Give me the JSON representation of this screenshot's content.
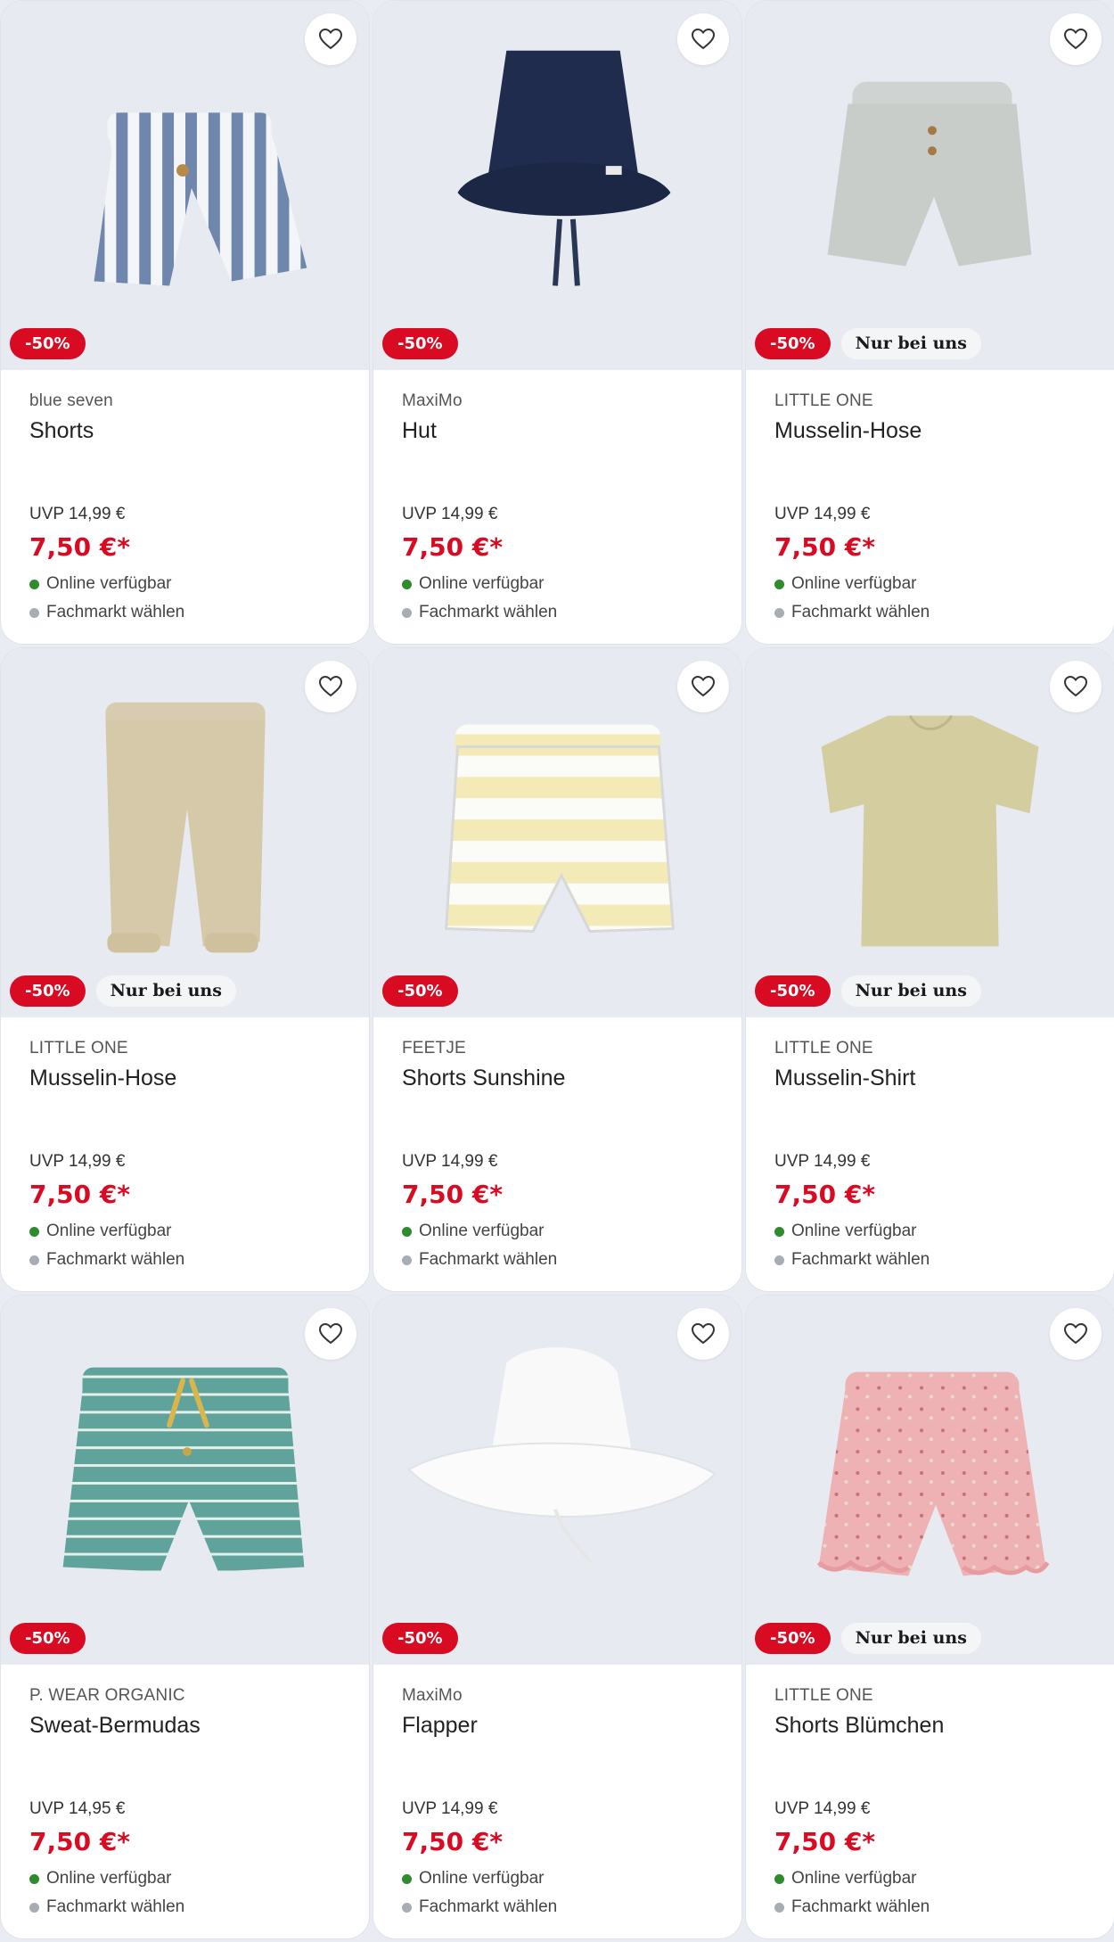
{
  "products": [
    {
      "brand": "blue seven",
      "name": "Shorts",
      "uvp": "UVP 14,99 €",
      "price": "7,50 €*",
      "discount": "-50%",
      "exclusive": "",
      "availability": "Online verfügbar",
      "store": "Fachmarkt wählen",
      "image": "striped-shorts"
    },
    {
      "brand": "MaxiMo",
      "name": "Hut",
      "uvp": "UVP 14,99 €",
      "price": "7,50 €*",
      "discount": "-50%",
      "exclusive": "",
      "availability": "Online verfügbar",
      "store": "Fachmarkt wählen",
      "image": "navy-bucket-hat"
    },
    {
      "brand": "LITTLE ONE",
      "name": "Musselin-Hose",
      "uvp": "UVP 14,99 €",
      "price": "7,50 €*",
      "discount": "-50%",
      "exclusive": "Nur bei uns",
      "availability": "Online verfügbar",
      "store": "Fachmarkt wählen",
      "image": "grey-muslin-shorts"
    },
    {
      "brand": "LITTLE ONE",
      "name": "Musselin-Hose",
      "uvp": "UVP 14,99 €",
      "price": "7,50 €*",
      "discount": "-50%",
      "exclusive": "Nur bei uns",
      "availability": "Online verfügbar",
      "store": "Fachmarkt wählen",
      "image": "beige-muslin-pants"
    },
    {
      "brand": "FEETJE",
      "name": "Shorts Sunshine",
      "uvp": "UVP 14,99 €",
      "price": "7,50 €*",
      "discount": "-50%",
      "exclusive": "",
      "availability": "Online verfügbar",
      "store": "Fachmarkt wählen",
      "image": "yellow-striped-shorts"
    },
    {
      "brand": "LITTLE ONE",
      "name": "Musselin-Shirt",
      "uvp": "UVP 14,99 €",
      "price": "7,50 €*",
      "discount": "-50%",
      "exclusive": "Nur bei uns",
      "availability": "Online verfügbar",
      "store": "Fachmarkt wählen",
      "image": "olive-muslin-shirt"
    },
    {
      "brand": "P. WEAR ORGANIC",
      "name": "Sweat-Bermudas",
      "uvp": "UVP 14,95 €",
      "price": "7,50 €*",
      "discount": "-50%",
      "exclusive": "",
      "availability": "Online verfügbar",
      "store": "Fachmarkt wählen",
      "image": "teal-striped-bermudas"
    },
    {
      "brand": "MaxiMo",
      "name": "Flapper",
      "uvp": "UVP 14,99 €",
      "price": "7,50 €*",
      "discount": "-50%",
      "exclusive": "",
      "availability": "Online verfügbar",
      "store": "Fachmarkt wählen",
      "image": "white-flapper-hat"
    },
    {
      "brand": "LITTLE ONE",
      "name": "Shorts Blümchen",
      "uvp": "UVP 14,99 €",
      "price": "7,50 €*",
      "discount": "-50%",
      "exclusive": "Nur bei uns",
      "availability": "Online verfügbar",
      "store": "Fachmarkt wählen",
      "image": "pink-floral-shorts"
    }
  ],
  "icons": {
    "favorite": "heart-outline-icon",
    "online": "green-dot-icon",
    "store": "grey-dot-icon"
  },
  "colors": {
    "price": "#d90b23",
    "discount_badge": "#d90b23",
    "online_dot": "#2e8b2e",
    "store_dot": "#a8acb3",
    "card_image_bg": "#e7eaf1"
  }
}
